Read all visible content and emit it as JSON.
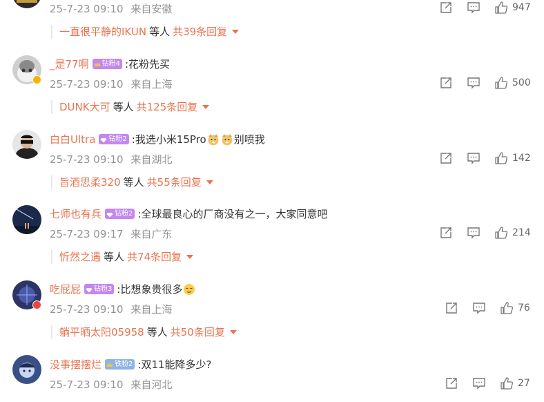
{
  "top_partial": {
    "time": "25-7-23 09:10",
    "location": "来自安徽",
    "likes": "947",
    "reply": {
      "name": "一直很平静的IKUN",
      "deng": "等人",
      "total": "共39条回复"
    }
  },
  "comments": [
    {
      "user": "_是77啊",
      "fan_badge": "钻粉4",
      "fan_color": "#c387f0",
      "text": ":花粉先买",
      "time": "25-7-23 09:10",
      "location": "来自上海",
      "likes": "500",
      "reply": {
        "name": "DUNK大可",
        "deng": "等人",
        "total": "共125条回复"
      }
    },
    {
      "user": "白白Ultra",
      "fan_badge": "钻粉2",
      "fan_color": "#c387f0",
      "text": ":我选小米15Pro",
      "text_after": "别喷我",
      "time": "25-7-23 09:10",
      "location": "来自湖北",
      "likes": "142",
      "reply": {
        "name": "旨酒思柔320",
        "deng": "等人",
        "total": "共55条回复"
      }
    },
    {
      "user": "七师也有兵",
      "fan_badge": "钻粉2",
      "fan_color": "#c387f0",
      "text": ":全球最良心的厂商没有之一，大家同意吧",
      "time": "25-7-23 09:17",
      "location": "来自广东",
      "likes": "214",
      "reply": {
        "name": "忻然之遇",
        "deng": "等人",
        "total": "共74条回复"
      }
    },
    {
      "user": "吃屁屁",
      "fan_badge": "钻粉3",
      "fan_color": "#c387f0",
      "text": ":比想象贵很多",
      "time": "25-7-23 09:10",
      "location": "来自上海",
      "likes": "76",
      "reply": {
        "name": "躺平晒太阳05958",
        "deng": "等人",
        "total": "共50条回复"
      }
    },
    {
      "user": "没事摆摆烂",
      "fan_badge": "铁粉2",
      "fan_color": "#8cb4e6",
      "text": ":双11能降多少?",
      "time": "25-7-23 09:10",
      "location": "来自河北",
      "likes": "27"
    }
  ],
  "icons": {
    "share": "share-icon",
    "comment": "comment-icon",
    "like": "thumbs-up-icon"
  },
  "colors": {
    "username": "#eb7350",
    "meta": "#939393",
    "icon": "#777777"
  }
}
